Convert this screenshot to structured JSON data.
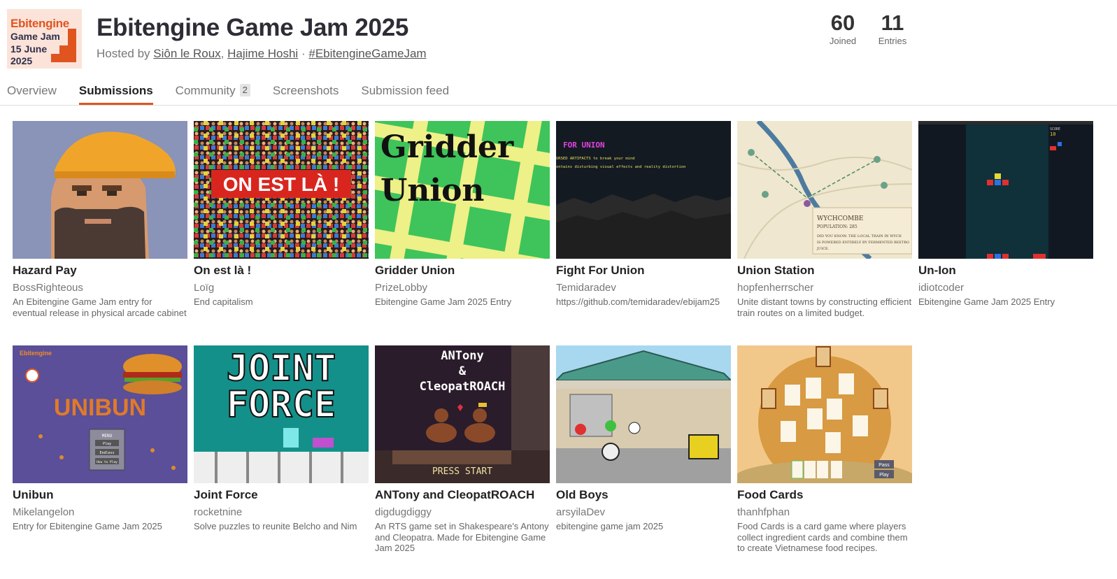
{
  "logo": {
    "line1": "Ebitengine",
    "line2": "Game Jam",
    "line3": "15 June",
    "line4": "2025"
  },
  "jam": {
    "title": "Ebitengine Game Jam 2025",
    "hosted_prefix": "Hosted by",
    "hosts": [
      "Siôn le Roux",
      "Hajime Hoshi"
    ],
    "separator": "·",
    "hashtag": "#EbitengineGameJam"
  },
  "stats": {
    "joined": {
      "value": "60",
      "label": "Joined"
    },
    "entries": {
      "value": "11",
      "label": "Entries"
    }
  },
  "tabs": [
    {
      "label": "Overview",
      "active": false
    },
    {
      "label": "Submissions",
      "active": true
    },
    {
      "label": "Community",
      "badge": "2",
      "active": false
    },
    {
      "label": "Screenshots",
      "active": false
    },
    {
      "label": "Submission feed",
      "active": false
    }
  ],
  "games": [
    {
      "title": "Hazard Pay",
      "author": "BossRighteous",
      "description": "An Ebitengine Game Jam entry for eventual release in physical arcade cabinet"
    },
    {
      "title": "On est là !",
      "author": "Loïg",
      "description": "End capitalism",
      "thumb_text": "ON EST LÀ !"
    },
    {
      "title": "Gridder Union",
      "author": "PrizeLobby",
      "description": "Ebitengine Game Jam 2025 Entry",
      "thumb_text": [
        "Gridder",
        "Union"
      ]
    },
    {
      "title": "Fight For Union",
      "author": "Temidaradev",
      "description": "https://github.com/temidaradev/ebijam25",
      "thumb_text": [
        "FOR UNION",
        "URSED ARTIFACTS to break your mind",
        "ontains disturbing visual effects and reality distortion"
      ]
    },
    {
      "title": "Union Station",
      "author": "hopfenherrscher",
      "description": "Unite distant towns by constructing efficient train routes on a limited budget.",
      "thumb_text": [
        "WYCHCOMBE",
        "POPULATION: 285",
        "DID YOU KNOW: THE LOCAL TRAIN IN WYCH",
        "IS POWERED ENTIRELY BY FERMENTED BEETRO",
        "JUICE."
      ]
    },
    {
      "title": "Un-Ion",
      "author": "idiotcoder",
      "description": "Ebitengine Game Jam 2025 Entry",
      "thumb_text": [
        "SCORE",
        "10"
      ]
    },
    {
      "title": "Unibun",
      "author": "Mikelangelon",
      "description": "Entry for Ebitengine Game Jam 2025",
      "thumb_text": [
        "Ebitengine",
        "UNIBUN",
        "MENU",
        "Play",
        "Endless",
        "How to Play"
      ]
    },
    {
      "title": "Joint Force",
      "author": "rocketnine",
      "description": "Solve puzzles to reunite Belcho and Nim",
      "thumb_text": [
        "JOINT",
        "FORCE"
      ]
    },
    {
      "title": "ANTony and CleopatROACH",
      "author": "digdugdiggy",
      "description": "An RTS game set in Shakespeare's Antony and Cleopatra. Made for Ebitengine Game Jam 2025",
      "thumb_text": [
        "ANTony",
        "&",
        "CleopatROACH",
        "PRESS START"
      ]
    },
    {
      "title": "Old Boys",
      "author": "arsyilaDev",
      "description": "ebitengine game jam 2025"
    },
    {
      "title": "Food Cards",
      "author": "thanhfphan",
      "description": "Food Cards is a card game where players collect ingredient cards and combine them to create Vietnamese food recipes.",
      "thumb_text": [
        "Pass",
        "Play"
      ]
    }
  ],
  "colors": {
    "accent": "#e0541f",
    "title": "#2d2d36",
    "muted": "#777777",
    "divider": "#dddddd"
  }
}
